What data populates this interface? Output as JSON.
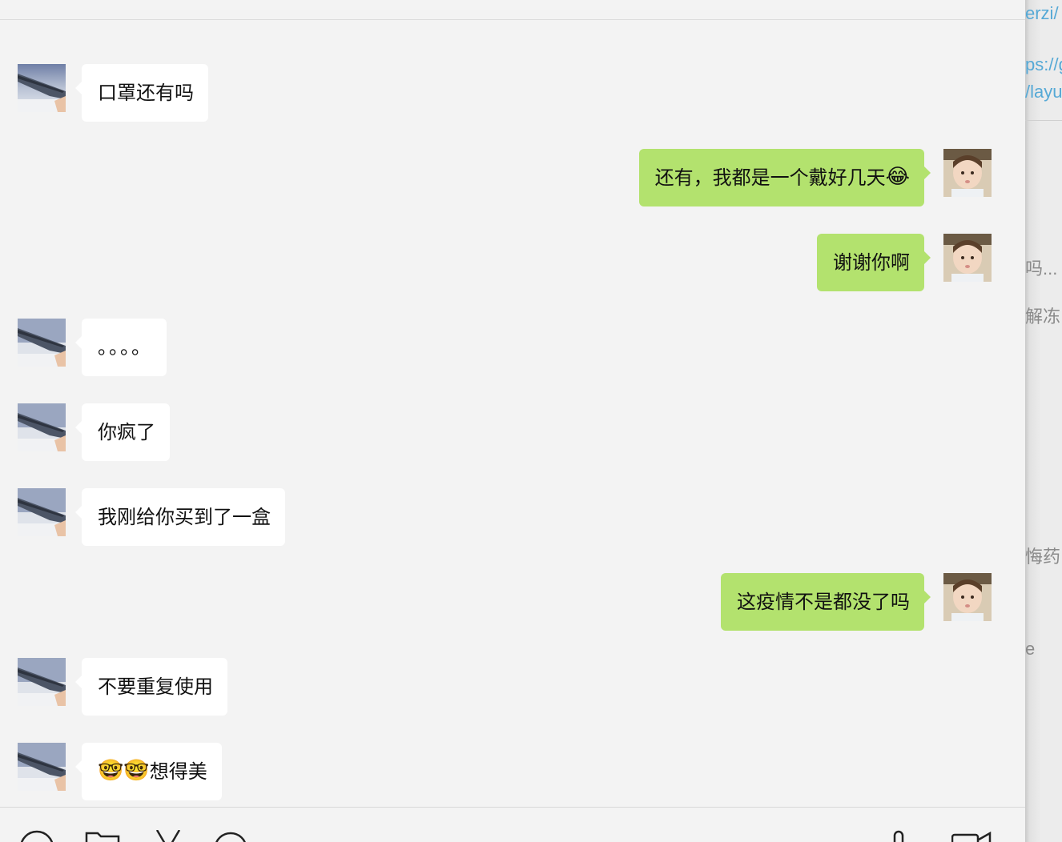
{
  "messages": [
    {
      "side": "left",
      "text": "口罩还有吗"
    },
    {
      "side": "right",
      "text": "还有，我都是一个戴好几天",
      "emoji": "😂"
    },
    {
      "side": "right",
      "text": "谢谢你啊"
    },
    {
      "side": "left",
      "text": "。。。。"
    },
    {
      "side": "left",
      "text": "你疯了"
    },
    {
      "side": "left",
      "text": "我刚给你买到了一盒"
    },
    {
      "side": "right",
      "text": "这疫情不是都没了吗"
    },
    {
      "side": "left",
      "text": "不要重复使用"
    },
    {
      "side": "left",
      "text": "想得美",
      "emoji_prefix": "🤓🤓"
    }
  ],
  "toolbar": {
    "icons": [
      "emoji-icon",
      "folder-icon",
      "scissors-icon",
      "chat-bubble-icon",
      "microphone-icon",
      "video-call-icon"
    ]
  },
  "side_window": {
    "link_lines": [
      "erzi/",
      "ps://g",
      "/layu"
    ],
    "preview_lines": [
      "吗...",
      "解冻",
      "悔药.",
      "e"
    ]
  },
  "colors": {
    "background": "#f3f3f3",
    "incoming_bubble": "#ffffff",
    "outgoing_bubble": "#b3e26e",
    "link": "#56a9d6"
  }
}
